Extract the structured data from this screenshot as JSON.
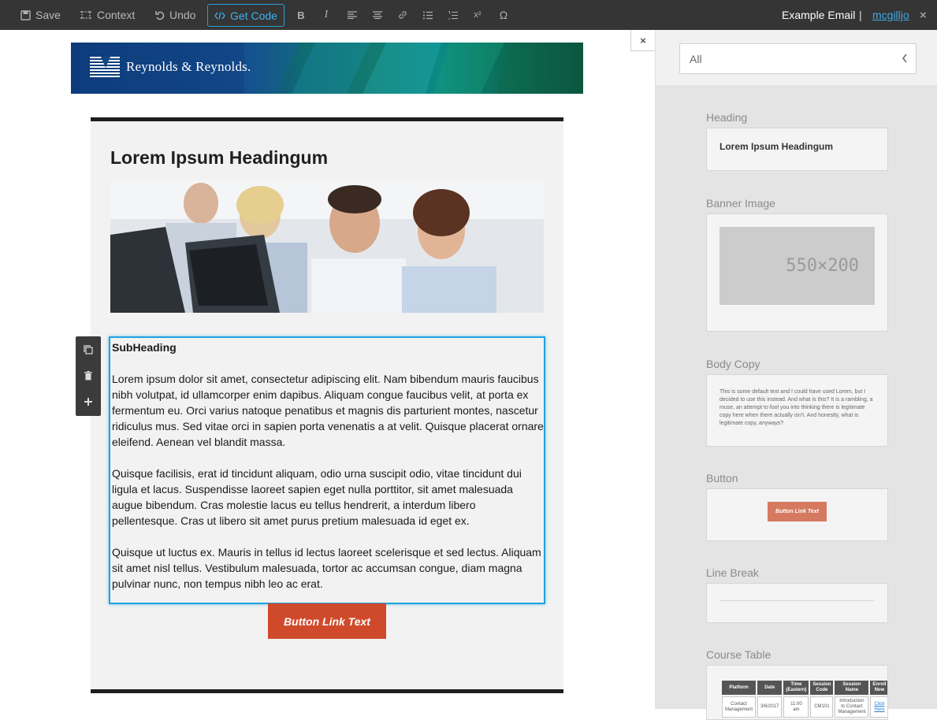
{
  "toolbar": {
    "save": "Save",
    "context": "Context",
    "undo": "Undo",
    "get_code": "Get Code",
    "bold": "B",
    "italic": "I",
    "superscript": "x²",
    "omega": "Ω",
    "email_name": "Example Email",
    "separator": "|",
    "user": "mcgilljo",
    "close": "×"
  },
  "email": {
    "logo_text": "Reynolds & Reynolds.",
    "heading": "Lorem Ipsum Headingum",
    "subheading": "SubHeading",
    "paragraphs": [
      "Lorem ipsum dolor sit amet, consectetur adipiscing elit. Nam bibendum mauris faucibus nibh volutpat, id ullamcorper enim dapibus. Aliquam congue faucibus velit, at porta ex fermentum eu. Orci varius natoque penatibus et magnis dis parturient montes, nascetur ridiculus mus. Sed vitae orci in sapien porta venenatis a at velit. Quisque placerat ornare eleifend. Aenean vel blandit massa.",
      "Quisque facilisis, erat id tincidunt aliquam, odio urna suscipit odio, vitae tincidunt dui ligula et lacus. Suspendisse laoreet sapien eget nulla porttitor, sit amet malesuada augue bibendum. Cras molestie lacus eu tellus hendrerit, a interdum libero pellentesque. Cras ut libero sit amet purus pretium malesuada id eget ex.",
      "Quisque ut luctus ex. Mauris in tellus id lectus laoreet scelerisque et sed lectus. Aliquam sit amet nisl tellus. Vestibulum malesuada, tortor ac accumsan congue, diam magna pulvinar nunc, non tempus nibh leo ac erat."
    ],
    "button": "Button Link Text"
  },
  "sidebar": {
    "filter": "All",
    "close": "×",
    "blocks": {
      "heading_label": "Heading",
      "heading_preview": "Lorem Ipsum Headingum",
      "banner_label": "Banner Image",
      "banner_placeholder": "550×200",
      "body_label": "Body Copy",
      "body_preview": "This is some default text and I could have used Lorem, but I decided to use this instead. And what is this? It is a rambling, a muse, an attempt to fool you into thinking there is legitimate copy here when there actually isn't. And honestly, what is legitimate copy, anyways?",
      "button_label": "Button",
      "button_preview": "Button Link Text",
      "line_label": "Line Break",
      "table_label": "Course Table"
    },
    "course_table": {
      "headers": [
        "Platform",
        "Date",
        "Time (Eastern)",
        "Session Code",
        "Session Name",
        "Enroll Now"
      ],
      "row": [
        "Contact Management",
        "3/6/2017",
        "11:00 am",
        "CM101",
        "Introduction to Contact Management",
        "Click Here"
      ]
    }
  },
  "colors": {
    "toolbar_bg": "#353535",
    "accent_blue": "#21a0e0",
    "cta": "#cf4a2b",
    "sidebar_bg": "#e4e4e4"
  }
}
